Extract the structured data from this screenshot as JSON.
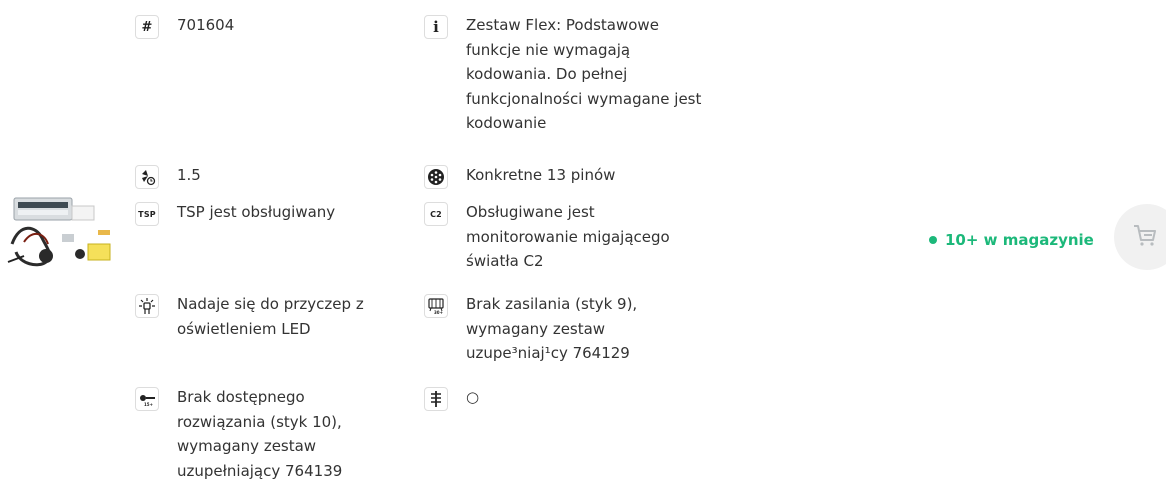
{
  "product": {
    "image_alt": "wiring kit"
  },
  "specs_left": [
    {
      "icon": "hash-icon",
      "icon_text": "#",
      "text": "701604"
    },
    {
      "icon": "fan-clock-icon",
      "icon_text": "",
      "text": "1.5"
    },
    {
      "icon": "tsp-icon",
      "icon_text": "TSP",
      "text": "TSP jest obsługiwany"
    },
    {
      "icon": "led-light-icon",
      "icon_text": "",
      "text": "Nadaje się do przyczep z oświetleniem LED"
    },
    {
      "icon": "plug-pin-icon",
      "icon_text": "",
      "text": "Brak dostępnego rozwiązania (styk 10), wymagany zestaw uzupełniający 764139"
    }
  ],
  "specs_right": [
    {
      "icon": "info-icon",
      "icon_text": "i",
      "text": "Zestaw Flex: Podstawowe funkcje nie wymagają kodowania. Do pełnej funkcjonalności wymagane jest kodowanie"
    },
    {
      "icon": "socket-13-pin-icon",
      "icon_text": "",
      "text": "Konkretne 13 pinów"
    },
    {
      "icon": "c2-icon",
      "icon_text": "C2",
      "text": "Obsługiwane jest monitorowanie migającego światła C2"
    },
    {
      "icon": "power-supply-icon",
      "icon_text": "",
      "text": "Brak zasilania (styk 9), wymagany zestaw uzupe³niaj¹cy 764129"
    },
    {
      "icon": "coding-lines-icon",
      "icon_text": "",
      "text": "○"
    }
  ],
  "availability": {
    "label": "10+ w magazynie",
    "color": "#1cb87a"
  },
  "cart": {
    "icon": "cart-icon"
  }
}
